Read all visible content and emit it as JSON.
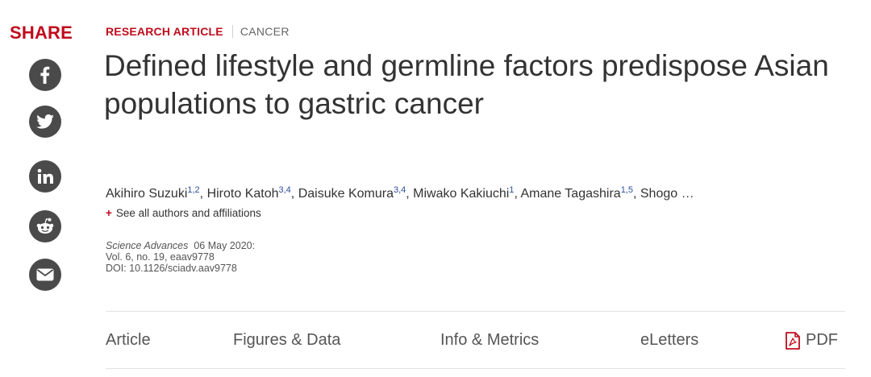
{
  "share": {
    "label": "SHARE",
    "buttons": [
      {
        "name": "facebook",
        "icon": "facebook-icon"
      },
      {
        "name": "twitter",
        "icon": "twitter-icon"
      },
      {
        "name": "linkedin",
        "icon": "linkedin-icon"
      },
      {
        "name": "reddit",
        "icon": "reddit-icon"
      },
      {
        "name": "email",
        "icon": "email-icon"
      }
    ]
  },
  "article": {
    "type": "RESEARCH ARTICLE",
    "subject": "CANCER",
    "title": "Defined lifestyle and germline factors predispose Asian populations to gastric cancer",
    "authors": [
      {
        "name": "Akihiro Suzuki",
        "aff": "1,2"
      },
      {
        "name": "Hiroto Katoh",
        "aff": "3,4"
      },
      {
        "name": "Daisuke Komura",
        "aff": "3,4"
      },
      {
        "name": "Miwako Kakiuchi",
        "aff": "1"
      },
      {
        "name": "Amane Tagashira",
        "aff": "1,5"
      }
    ],
    "authors_truncated": "Shogo …",
    "see_all_plus": "+",
    "see_all": "See all authors and affiliations",
    "journal": "Science Advances",
    "date": "06 May 2020:",
    "volume": "Vol. 6, no. 19, eaav9778",
    "doi": "DOI: 10.1126/sciadv.aav9778"
  },
  "tabs": {
    "article": "Article",
    "figures": "Figures & Data",
    "info": "Info & Metrics",
    "eletters": "eLetters",
    "pdf": "PDF"
  },
  "colors": {
    "accent": "#c00c1c",
    "icon_bg": "#4a4a4a",
    "superscript": "#2d4da0"
  }
}
